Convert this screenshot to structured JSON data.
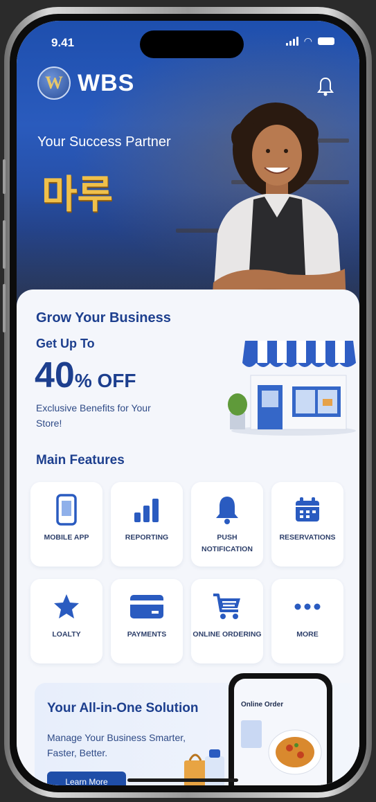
{
  "status_bar": {
    "time": "9.41"
  },
  "header": {
    "brand": "WBS",
    "logo_letter": "W"
  },
  "hero": {
    "tagline": "Your Success Partner",
    "korean_text": "마루"
  },
  "promo_top": {
    "title": "Grow Your Business",
    "get_up_to": "Get Up To",
    "discount_number": "40",
    "discount_suffix": "% OFF",
    "description": "Exclusive Benefits for Your Store!"
  },
  "features": {
    "title": "Main Features",
    "items": [
      {
        "label": "MOBILE APP",
        "icon": "mobile-icon"
      },
      {
        "label": "REPORTING",
        "icon": "bar-chart-icon"
      },
      {
        "label": "PUSH NOTIFICATION",
        "icon": "bell-icon"
      },
      {
        "label": "RESERVATIONS",
        "icon": "calendar-icon"
      },
      {
        "label": "LOALTY",
        "icon": "star-icon"
      },
      {
        "label": "PAYMENTS",
        "icon": "credit-card-icon"
      },
      {
        "label": "ONLINE ORDERING",
        "icon": "cart-icon"
      },
      {
        "label": "MORE",
        "icon": "more-dots-icon"
      }
    ]
  },
  "solution": {
    "title": "Your All-in-One Solution",
    "subtitle": "Manage Your Business Smarter, Faster, Better.",
    "button": "Learn More",
    "mock_phone_title": "Online Order"
  },
  "colors": {
    "primary": "#1d3f8e",
    "hero_blue": "#2a5bbd",
    "accent_gold": "#f0c04a"
  }
}
